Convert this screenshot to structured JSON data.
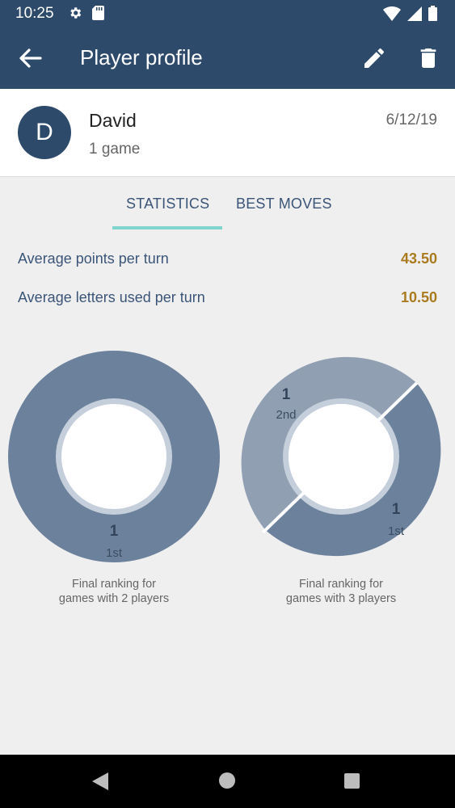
{
  "status_bar": {
    "time": "10:25",
    "left_icons": [
      "gear-icon",
      "sd-card-icon"
    ],
    "right_icons": [
      "wifi-icon",
      "signal-icon",
      "battery-icon"
    ]
  },
  "app_bar": {
    "title": "Player profile",
    "background": "#2d4a6b",
    "icons": [
      "arrow-back-icon",
      "pencil-icon",
      "trash-icon"
    ]
  },
  "profile": {
    "avatar_letter": "D",
    "name": "David",
    "games": "1 game",
    "date": "6/12/19"
  },
  "tabs": {
    "statistics": "STATISTICS",
    "best_moves": "BEST MOVES",
    "active": "statistics",
    "indicator_color": "#7fd5cc"
  },
  "stats": [
    {
      "label": "Average points per turn",
      "value": "43.50"
    },
    {
      "label": "Average letters used per turn",
      "value": "10.50"
    }
  ],
  "charts": [
    {
      "caption_line1": "Final ranking for",
      "caption_line2": "games with 2 players",
      "slices": [
        {
          "rank": "1st",
          "count": "1",
          "value": 1,
          "color": "#6b819c"
        }
      ]
    },
    {
      "caption_line1": "Final ranking for",
      "caption_line2": "games with 3 players",
      "slices": [
        {
          "rank": "1st",
          "count": "1",
          "value": 1,
          "color": "#6b819c"
        },
        {
          "rank": "2nd",
          "count": "1",
          "value": 1,
          "color": "#909fb2"
        }
      ]
    }
  ],
  "colors": {
    "primary": "#2d4a6b",
    "accent_value": "#a97b1e",
    "text_label": "#3a5577"
  },
  "nav_bar": {
    "icons": [
      "nav-back-icon",
      "nav-home-icon",
      "nav-recent-icon"
    ]
  }
}
